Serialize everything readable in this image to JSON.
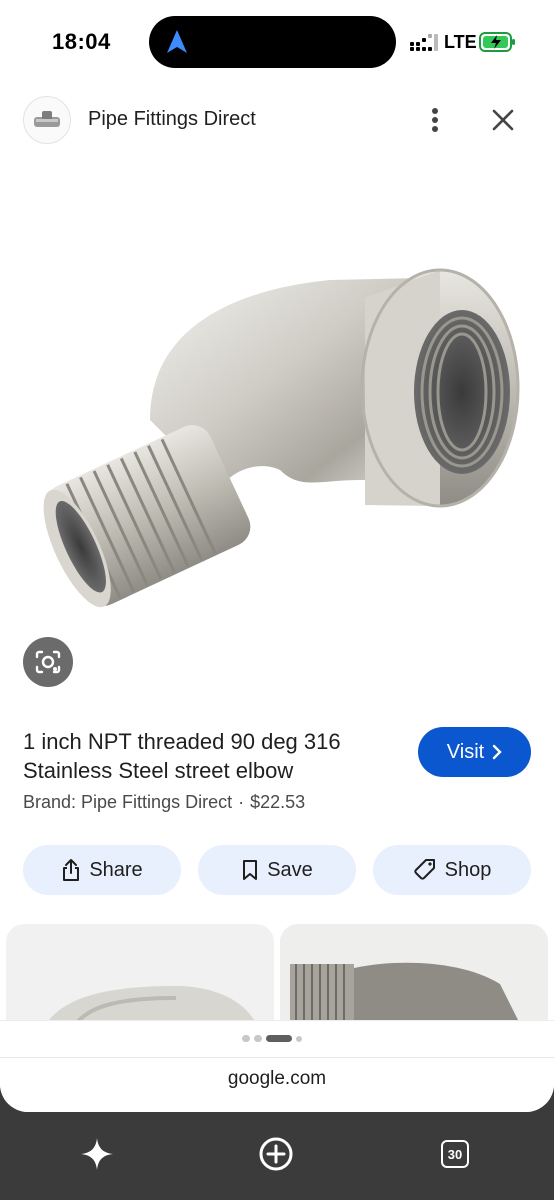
{
  "status_bar": {
    "time": "18:04",
    "network": "LTE",
    "icons": [
      "navigation-arrow-icon",
      "signal-icon",
      "battery-charging-icon"
    ]
  },
  "header": {
    "site_name": "Pipe Fittings Direct",
    "icons": [
      "site-logo-icon",
      "more-vert-icon",
      "close-icon"
    ]
  },
  "product": {
    "title": "1 inch NPT threaded 90 deg 316 Stainless Steel street elbow",
    "brand": "Brand: Pipe Fittings Direct",
    "separator": "·",
    "price": "$22.53",
    "image_icon": "pipe-elbow-image"
  },
  "actions": {
    "visit": "Visit",
    "share": "Share",
    "save": "Save",
    "shop": "Shop"
  },
  "footer": {
    "domain": "google.com",
    "pager_active_index": 2
  },
  "bottom_nav": {
    "tab_count": "30",
    "icons": [
      "sparkle-icon",
      "add-circle-icon",
      "tabs-icon"
    ]
  },
  "colors": {
    "accent": "#0b57d0",
    "chip_bg": "#e8f0fe",
    "nav_bg": "#3b3b3b"
  }
}
